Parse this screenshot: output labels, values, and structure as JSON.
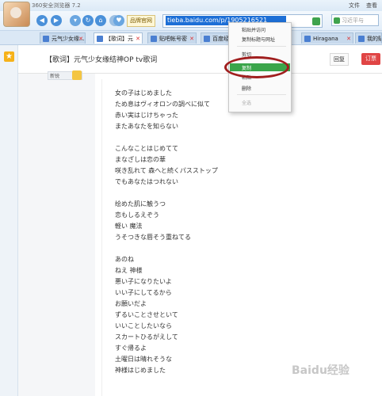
{
  "browser": {
    "title": "360安全浏览器 7.2",
    "menu": [
      "文件",
      "查看"
    ],
    "brand_label": "品牌官网",
    "url": "tieba.baidu.com/p/1905216521",
    "search_placeholder": "习近平与"
  },
  "tabs": [
    {
      "label": "元气少女缘..."
    },
    {
      "label": "【歌词】元"
    },
    {
      "label": "贴吧帐号密"
    },
    {
      "label": "百度经验"
    },
    {
      "label": "Hiragana"
    },
    {
      "label": "我的贴"
    }
  ],
  "context_menu": {
    "items": [
      {
        "label": "粘贴并访问",
        "enabled": true
      },
      {
        "label": "复制标题与网址",
        "enabled": true
      },
      {
        "label": "剪切",
        "enabled": true
      },
      {
        "label": "复制",
        "enabled": true,
        "highlighted": true
      },
      {
        "label": "粘贴",
        "enabled": true
      },
      {
        "label": "删除",
        "enabled": true
      },
      {
        "label": "全选",
        "enabled": false
      }
    ]
  },
  "post": {
    "title": "【歌词】元气少女缘结神OP tv歌词",
    "reply_label": "回复",
    "fav_label": "订票",
    "user_badge": "新锐"
  },
  "lyrics": [
    "女の子はじめました",
    "ため息はヴィオロンの調べに似て",
    "赤い実はじけちゃった",
    "またあなたを知らない",
    "",
    "こんなことはじめてて",
    "まなざしは恋の華",
    "咲き乱れて 森へと続くパスストップ",
    "でもあなたはつれない",
    "",
    "绘めた肌に触うつ",
    "恋もしるえぞう",
    "軽い 魔法",
    "うそつきな唇そう重ねてる",
    "",
    "あのね",
    "ねえ 神様",
    "悪い子になりたいよ",
    "いい子にしてるから",
    "お願いだよ",
    "ずるいことさせといて",
    "いいことしたいなら",
    "スカートひるがえして",
    "すぐ帰るよ",
    "土曜日は晴れそうな",
    "神様はじめました"
  ],
  "watermark": "Baidu经验",
  "accent_color": "#3aa54a",
  "highlight_ring_color": "#a01e1e"
}
